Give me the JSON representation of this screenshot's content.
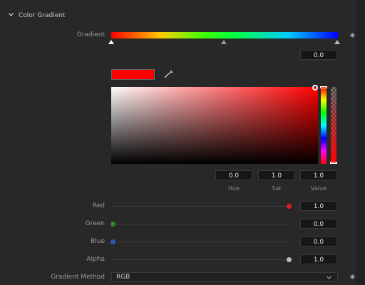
{
  "section": {
    "title": "Color Gradient"
  },
  "gradient": {
    "label": "Gradient",
    "position_value": "0.0"
  },
  "hsv": {
    "hue_value": "0.0",
    "sat_value": "1.0",
    "val_value": "1.0",
    "hue_label": "Hue",
    "sat_label": "Sat",
    "val_label": "Value"
  },
  "channels": {
    "red_label": "Red",
    "red_value": "1.0",
    "red_color": "#e02020",
    "green_label": "Green",
    "green_value": "0.0",
    "green_color": "#2a8a2a",
    "blue_label": "Blue",
    "blue_value": "0.0",
    "blue_color": "#2a5ab0",
    "alpha_label": "Alpha",
    "alpha_value": "1.0",
    "alpha_color": "#bdbdbd"
  },
  "method": {
    "label": "Gradient Method",
    "value": "RGB"
  },
  "current_color": "#ff0000",
  "icons": [
    "chevron-down-icon",
    "eyedropper-icon",
    "keyframe-diamond-icon",
    "dropdown-caret-icon"
  ]
}
